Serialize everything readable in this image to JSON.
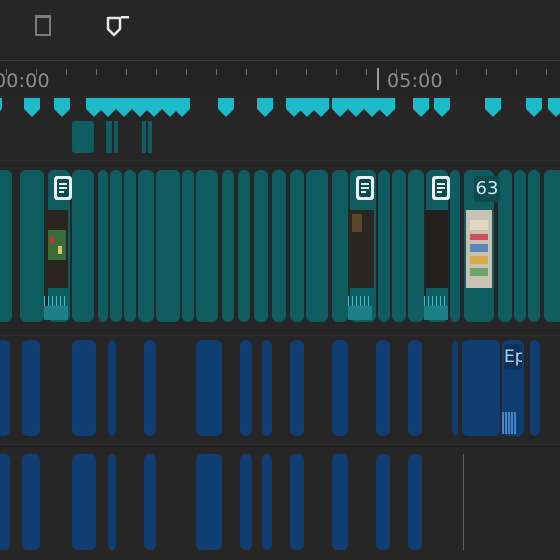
{
  "toolbar": {
    "delete_icon": "trash-icon",
    "marker_icon": "shield-marker-icon"
  },
  "ruler": {
    "labels": [
      "00:00",
      "05:00"
    ],
    "tick_color": "#6e6e6e",
    "label_color": "#8c8c8c"
  },
  "markers": {
    "color": "#1dbac9",
    "count": 22
  },
  "video_track": {
    "color": "#0f5c61",
    "clip_label": "63"
  },
  "audio_track": {
    "color": "#103e73",
    "clip_label": "Ep"
  },
  "colors": {
    "background": "#262626",
    "ruler_bg": "#232323",
    "track_bg": "#262626",
    "video_clip": "#0f5c61",
    "video_clip_dark": "#0c4a4f",
    "audio_clip": "#103e73",
    "audio_clip_dark": "#0c3259",
    "marker": "#1dbac9"
  }
}
